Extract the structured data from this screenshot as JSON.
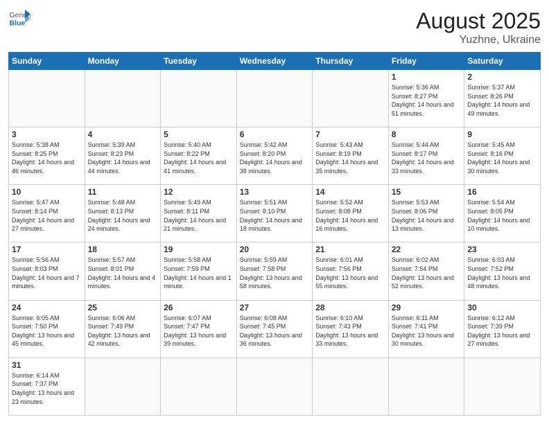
{
  "header": {
    "logo_general": "General",
    "logo_blue": "Blue",
    "title": "August 2025",
    "subtitle": "Yuzhne, Ukraine"
  },
  "weekdays": [
    "Sunday",
    "Monday",
    "Tuesday",
    "Wednesday",
    "Thursday",
    "Friday",
    "Saturday"
  ],
  "weeks": [
    [
      {
        "day": "",
        "info": ""
      },
      {
        "day": "",
        "info": ""
      },
      {
        "day": "",
        "info": ""
      },
      {
        "day": "",
        "info": ""
      },
      {
        "day": "",
        "info": ""
      },
      {
        "day": "1",
        "info": "Sunrise: 5:36 AM\nSunset: 8:27 PM\nDaylight: 14 hours\nand 51 minutes."
      },
      {
        "day": "2",
        "info": "Sunrise: 5:37 AM\nSunset: 8:26 PM\nDaylight: 14 hours\nand 49 minutes."
      }
    ],
    [
      {
        "day": "3",
        "info": "Sunrise: 5:38 AM\nSunset: 8:25 PM\nDaylight: 14 hours\nand 46 minutes."
      },
      {
        "day": "4",
        "info": "Sunrise: 5:39 AM\nSunset: 8:23 PM\nDaylight: 14 hours\nand 44 minutes."
      },
      {
        "day": "5",
        "info": "Sunrise: 5:40 AM\nSunset: 8:22 PM\nDaylight: 14 hours\nand 41 minutes."
      },
      {
        "day": "6",
        "info": "Sunrise: 5:42 AM\nSunset: 8:20 PM\nDaylight: 14 hours\nand 38 minutes."
      },
      {
        "day": "7",
        "info": "Sunrise: 5:43 AM\nSunset: 8:19 PM\nDaylight: 14 hours\nand 35 minutes."
      },
      {
        "day": "8",
        "info": "Sunrise: 5:44 AM\nSunset: 8:17 PM\nDaylight: 14 hours\nand 33 minutes."
      },
      {
        "day": "9",
        "info": "Sunrise: 5:45 AM\nSunset: 8:16 PM\nDaylight: 14 hours\nand 30 minutes."
      }
    ],
    [
      {
        "day": "10",
        "info": "Sunrise: 5:47 AM\nSunset: 8:14 PM\nDaylight: 14 hours\nand 27 minutes."
      },
      {
        "day": "11",
        "info": "Sunrise: 5:48 AM\nSunset: 8:13 PM\nDaylight: 14 hours\nand 24 minutes."
      },
      {
        "day": "12",
        "info": "Sunrise: 5:49 AM\nSunset: 8:11 PM\nDaylight: 14 hours\nand 21 minutes."
      },
      {
        "day": "13",
        "info": "Sunrise: 5:51 AM\nSunset: 8:10 PM\nDaylight: 14 hours\nand 18 minutes."
      },
      {
        "day": "14",
        "info": "Sunrise: 5:52 AM\nSunset: 8:08 PM\nDaylight: 14 hours\nand 16 minutes."
      },
      {
        "day": "15",
        "info": "Sunrise: 5:53 AM\nSunset: 8:06 PM\nDaylight: 14 hours\nand 13 minutes."
      },
      {
        "day": "16",
        "info": "Sunrise: 5:54 AM\nSunset: 8:05 PM\nDaylight: 14 hours\nand 10 minutes."
      }
    ],
    [
      {
        "day": "17",
        "info": "Sunrise: 5:56 AM\nSunset: 8:03 PM\nDaylight: 14 hours\nand 7 minutes."
      },
      {
        "day": "18",
        "info": "Sunrise: 5:57 AM\nSunset: 8:01 PM\nDaylight: 14 hours\nand 4 minutes."
      },
      {
        "day": "19",
        "info": "Sunrise: 5:58 AM\nSunset: 7:59 PM\nDaylight: 14 hours\nand 1 minute."
      },
      {
        "day": "20",
        "info": "Sunrise: 5:59 AM\nSunset: 7:58 PM\nDaylight: 13 hours\nand 58 minutes."
      },
      {
        "day": "21",
        "info": "Sunrise: 6:01 AM\nSunset: 7:56 PM\nDaylight: 13 hours\nand 55 minutes."
      },
      {
        "day": "22",
        "info": "Sunrise: 6:02 AM\nSunset: 7:54 PM\nDaylight: 13 hours\nand 52 minutes."
      },
      {
        "day": "23",
        "info": "Sunrise: 6:03 AM\nSunset: 7:52 PM\nDaylight: 13 hours\nand 48 minutes."
      }
    ],
    [
      {
        "day": "24",
        "info": "Sunrise: 6:05 AM\nSunset: 7:50 PM\nDaylight: 13 hours\nand 45 minutes."
      },
      {
        "day": "25",
        "info": "Sunrise: 6:06 AM\nSunset: 7:49 PM\nDaylight: 13 hours\nand 42 minutes."
      },
      {
        "day": "26",
        "info": "Sunrise: 6:07 AM\nSunset: 7:47 PM\nDaylight: 13 hours\nand 39 minutes."
      },
      {
        "day": "27",
        "info": "Sunrise: 6:08 AM\nSunset: 7:45 PM\nDaylight: 13 hours\nand 36 minutes."
      },
      {
        "day": "28",
        "info": "Sunrise: 6:10 AM\nSunset: 7:43 PM\nDaylight: 13 hours\nand 33 minutes."
      },
      {
        "day": "29",
        "info": "Sunrise: 6:11 AM\nSunset: 7:41 PM\nDaylight: 13 hours\nand 30 minutes."
      },
      {
        "day": "30",
        "info": "Sunrise: 6:12 AM\nSunset: 7:39 PM\nDaylight: 13 hours\nand 27 minutes."
      }
    ],
    [
      {
        "day": "31",
        "info": "Sunrise: 6:14 AM\nSunset: 7:37 PM\nDaylight: 13 hours\nand 23 minutes."
      },
      {
        "day": "",
        "info": ""
      },
      {
        "day": "",
        "info": ""
      },
      {
        "day": "",
        "info": ""
      },
      {
        "day": "",
        "info": ""
      },
      {
        "day": "",
        "info": ""
      },
      {
        "day": "",
        "info": ""
      }
    ]
  ]
}
